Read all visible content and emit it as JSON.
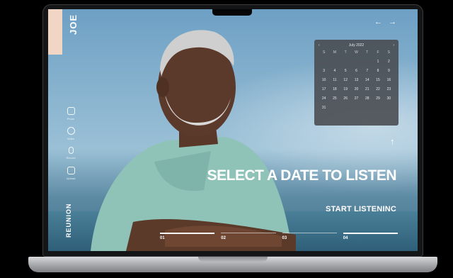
{
  "brand": {
    "name": "JOE",
    "wordmark": "REUNION"
  },
  "sidebar": {
    "items": [
      {
        "icon": "photo-icon",
        "label": "Photo"
      },
      {
        "icon": "video-icon",
        "label": "Video"
      },
      {
        "icon": "microphone-icon",
        "label": "Record"
      },
      {
        "icon": "upload-icon",
        "label": "Upload"
      }
    ]
  },
  "nav": {
    "prev": "←",
    "next": "→"
  },
  "calendar": {
    "month": "July 2022",
    "prev": "‹",
    "next": "›",
    "weekdays": [
      "S",
      "M",
      "T",
      "W",
      "T",
      "F",
      "S"
    ],
    "days": [
      "",
      "",
      "",
      "",
      "",
      "1",
      "2",
      "3",
      "4",
      "5",
      "6",
      "7",
      "8",
      "9",
      "10",
      "11",
      "12",
      "13",
      "14",
      "15",
      "16",
      "17",
      "18",
      "19",
      "20",
      "21",
      "22",
      "23",
      "24",
      "25",
      "26",
      "27",
      "28",
      "29",
      "30",
      "31",
      "",
      "",
      "",
      "",
      "",
      ""
    ]
  },
  "hero": {
    "up_arrow": "↑",
    "kicker": "",
    "headline": "SELECT A DATE TO LISTEN",
    "kicker2": "",
    "cta": "START LISTENINC"
  },
  "steps": [
    {
      "num": "01",
      "sub": ""
    },
    {
      "num": "02",
      "sub": ""
    },
    {
      "num": "03",
      "sub": ""
    },
    {
      "num": "04",
      "sub": ""
    }
  ],
  "colors": {
    "accent_block": "#f1d6c5",
    "calendar_bg": "#484a4e",
    "text": "#ffffff"
  }
}
